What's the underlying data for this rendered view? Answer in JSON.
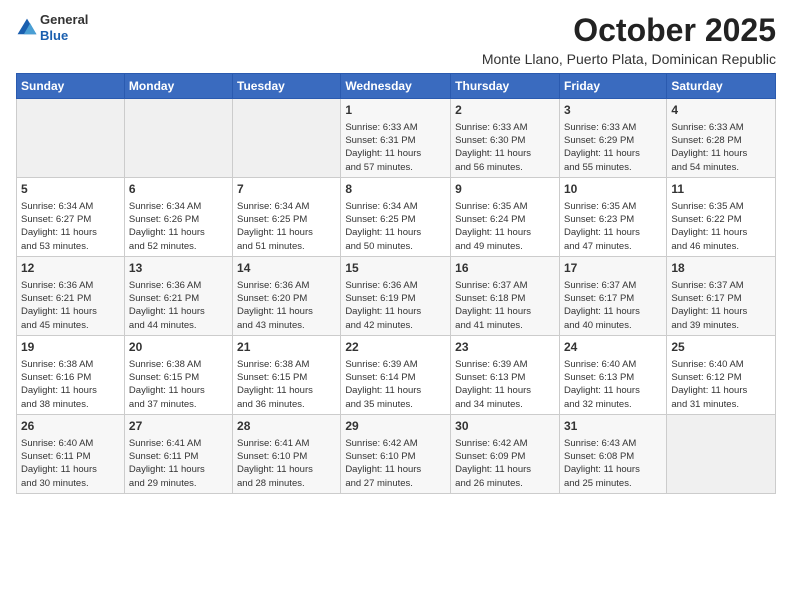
{
  "header": {
    "logo_general": "General",
    "logo_blue": "Blue",
    "month_title": "October 2025",
    "subtitle": "Monte Llano, Puerto Plata, Dominican Republic"
  },
  "days_of_week": [
    "Sunday",
    "Monday",
    "Tuesday",
    "Wednesday",
    "Thursday",
    "Friday",
    "Saturday"
  ],
  "weeks": [
    [
      {
        "day": "",
        "info": ""
      },
      {
        "day": "",
        "info": ""
      },
      {
        "day": "",
        "info": ""
      },
      {
        "day": "1",
        "info": "Sunrise: 6:33 AM\nSunset: 6:31 PM\nDaylight: 11 hours\nand 57 minutes."
      },
      {
        "day": "2",
        "info": "Sunrise: 6:33 AM\nSunset: 6:30 PM\nDaylight: 11 hours\nand 56 minutes."
      },
      {
        "day": "3",
        "info": "Sunrise: 6:33 AM\nSunset: 6:29 PM\nDaylight: 11 hours\nand 55 minutes."
      },
      {
        "day": "4",
        "info": "Sunrise: 6:33 AM\nSunset: 6:28 PM\nDaylight: 11 hours\nand 54 minutes."
      }
    ],
    [
      {
        "day": "5",
        "info": "Sunrise: 6:34 AM\nSunset: 6:27 PM\nDaylight: 11 hours\nand 53 minutes."
      },
      {
        "day": "6",
        "info": "Sunrise: 6:34 AM\nSunset: 6:26 PM\nDaylight: 11 hours\nand 52 minutes."
      },
      {
        "day": "7",
        "info": "Sunrise: 6:34 AM\nSunset: 6:25 PM\nDaylight: 11 hours\nand 51 minutes."
      },
      {
        "day": "8",
        "info": "Sunrise: 6:34 AM\nSunset: 6:25 PM\nDaylight: 11 hours\nand 50 minutes."
      },
      {
        "day": "9",
        "info": "Sunrise: 6:35 AM\nSunset: 6:24 PM\nDaylight: 11 hours\nand 49 minutes."
      },
      {
        "day": "10",
        "info": "Sunrise: 6:35 AM\nSunset: 6:23 PM\nDaylight: 11 hours\nand 47 minutes."
      },
      {
        "day": "11",
        "info": "Sunrise: 6:35 AM\nSunset: 6:22 PM\nDaylight: 11 hours\nand 46 minutes."
      }
    ],
    [
      {
        "day": "12",
        "info": "Sunrise: 6:36 AM\nSunset: 6:21 PM\nDaylight: 11 hours\nand 45 minutes."
      },
      {
        "day": "13",
        "info": "Sunrise: 6:36 AM\nSunset: 6:21 PM\nDaylight: 11 hours\nand 44 minutes."
      },
      {
        "day": "14",
        "info": "Sunrise: 6:36 AM\nSunset: 6:20 PM\nDaylight: 11 hours\nand 43 minutes."
      },
      {
        "day": "15",
        "info": "Sunrise: 6:36 AM\nSunset: 6:19 PM\nDaylight: 11 hours\nand 42 minutes."
      },
      {
        "day": "16",
        "info": "Sunrise: 6:37 AM\nSunset: 6:18 PM\nDaylight: 11 hours\nand 41 minutes."
      },
      {
        "day": "17",
        "info": "Sunrise: 6:37 AM\nSunset: 6:17 PM\nDaylight: 11 hours\nand 40 minutes."
      },
      {
        "day": "18",
        "info": "Sunrise: 6:37 AM\nSunset: 6:17 PM\nDaylight: 11 hours\nand 39 minutes."
      }
    ],
    [
      {
        "day": "19",
        "info": "Sunrise: 6:38 AM\nSunset: 6:16 PM\nDaylight: 11 hours\nand 38 minutes."
      },
      {
        "day": "20",
        "info": "Sunrise: 6:38 AM\nSunset: 6:15 PM\nDaylight: 11 hours\nand 37 minutes."
      },
      {
        "day": "21",
        "info": "Sunrise: 6:38 AM\nSunset: 6:15 PM\nDaylight: 11 hours\nand 36 minutes."
      },
      {
        "day": "22",
        "info": "Sunrise: 6:39 AM\nSunset: 6:14 PM\nDaylight: 11 hours\nand 35 minutes."
      },
      {
        "day": "23",
        "info": "Sunrise: 6:39 AM\nSunset: 6:13 PM\nDaylight: 11 hours\nand 34 minutes."
      },
      {
        "day": "24",
        "info": "Sunrise: 6:40 AM\nSunset: 6:13 PM\nDaylight: 11 hours\nand 32 minutes."
      },
      {
        "day": "25",
        "info": "Sunrise: 6:40 AM\nSunset: 6:12 PM\nDaylight: 11 hours\nand 31 minutes."
      }
    ],
    [
      {
        "day": "26",
        "info": "Sunrise: 6:40 AM\nSunset: 6:11 PM\nDaylight: 11 hours\nand 30 minutes."
      },
      {
        "day": "27",
        "info": "Sunrise: 6:41 AM\nSunset: 6:11 PM\nDaylight: 11 hours\nand 29 minutes."
      },
      {
        "day": "28",
        "info": "Sunrise: 6:41 AM\nSunset: 6:10 PM\nDaylight: 11 hours\nand 28 minutes."
      },
      {
        "day": "29",
        "info": "Sunrise: 6:42 AM\nSunset: 6:10 PM\nDaylight: 11 hours\nand 27 minutes."
      },
      {
        "day": "30",
        "info": "Sunrise: 6:42 AM\nSunset: 6:09 PM\nDaylight: 11 hours\nand 26 minutes."
      },
      {
        "day": "31",
        "info": "Sunrise: 6:43 AM\nSunset: 6:08 PM\nDaylight: 11 hours\nand 25 minutes."
      },
      {
        "day": "",
        "info": ""
      }
    ]
  ]
}
